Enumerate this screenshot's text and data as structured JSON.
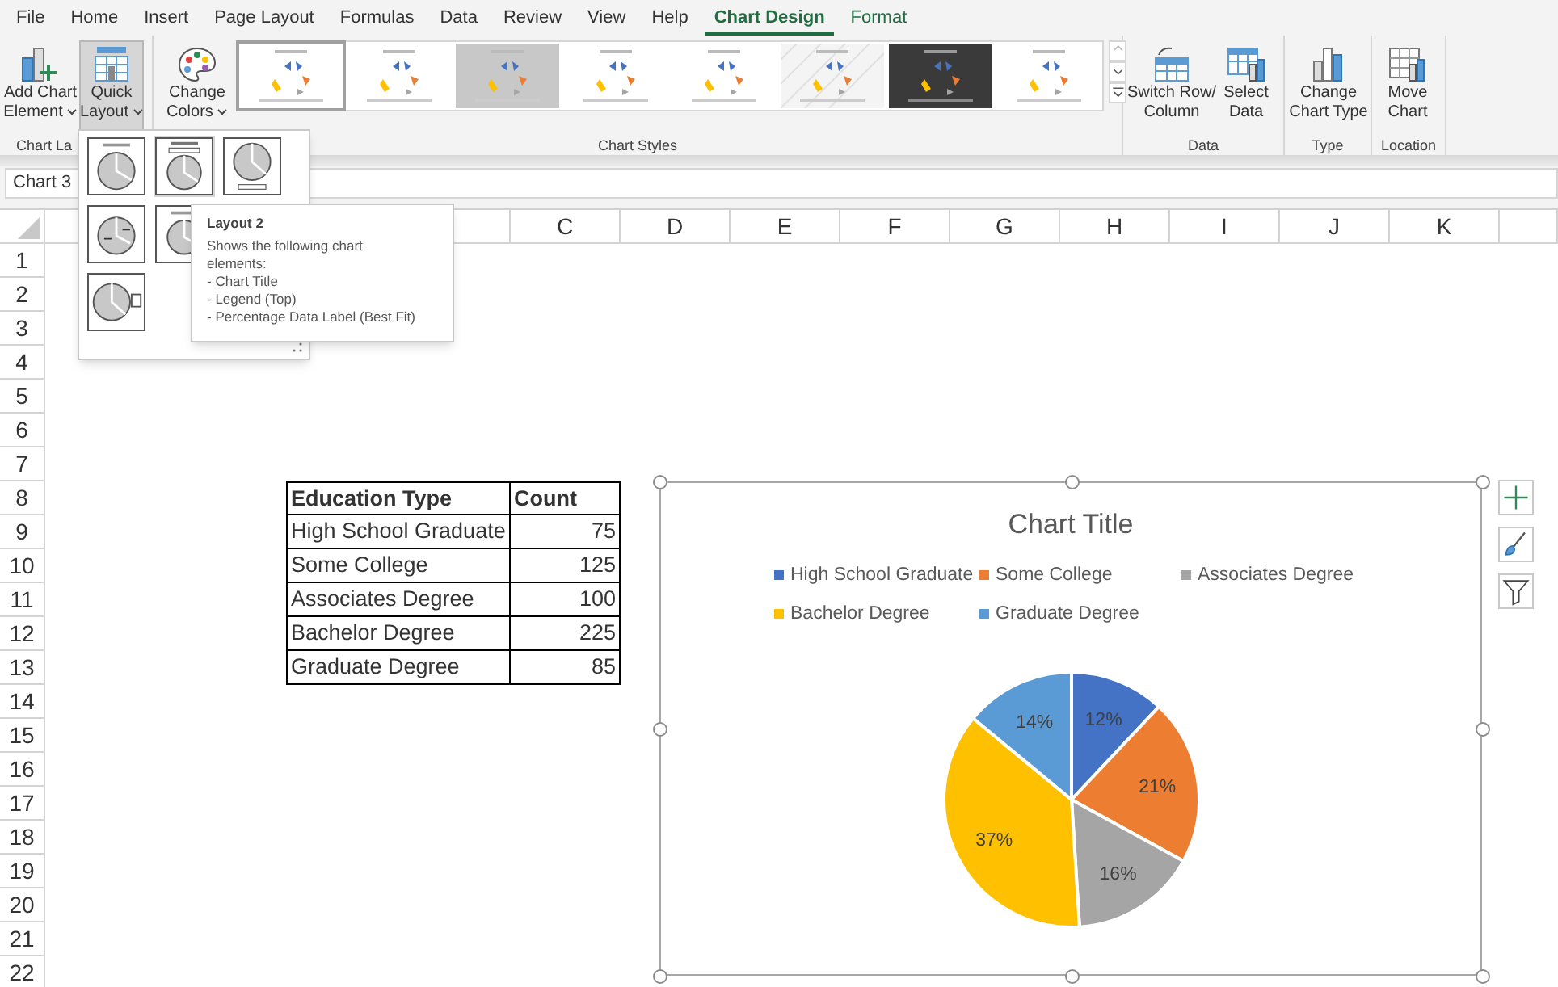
{
  "tabs": [
    {
      "label": "File",
      "selected": false,
      "kind": "normal"
    },
    {
      "label": "Home",
      "selected": false,
      "kind": "normal"
    },
    {
      "label": "Insert",
      "selected": false,
      "kind": "normal"
    },
    {
      "label": "Page Layout",
      "selected": false,
      "kind": "normal"
    },
    {
      "label": "Formulas",
      "selected": false,
      "kind": "normal"
    },
    {
      "label": "Data",
      "selected": false,
      "kind": "normal"
    },
    {
      "label": "Review",
      "selected": false,
      "kind": "normal"
    },
    {
      "label": "View",
      "selected": false,
      "kind": "normal"
    },
    {
      "label": "Help",
      "selected": false,
      "kind": "normal"
    },
    {
      "label": "Chart Design",
      "selected": true,
      "kind": "contextual"
    },
    {
      "label": "Format",
      "selected": false,
      "kind": "contextual"
    }
  ],
  "ribbon": {
    "layouts_group": {
      "label": "Chart La",
      "buttons": [
        {
          "lines": [
            "Add Chart",
            "Element"
          ],
          "dropdown": true,
          "pressed": false
        },
        {
          "lines": [
            "Quick",
            "Layout"
          ],
          "dropdown": true,
          "pressed": true
        }
      ]
    },
    "styles_group": {
      "label": "Chart Styles",
      "color_button": {
        "lines": [
          "Change",
          "Colors"
        ],
        "dropdown": true
      },
      "thumbnails": [
        {
          "kind": "light",
          "selected": true
        },
        {
          "kind": "light",
          "selected": false
        },
        {
          "kind": "gray",
          "selected": false
        },
        {
          "kind": "light",
          "selected": false
        },
        {
          "kind": "light",
          "selected": false
        },
        {
          "kind": "pattern",
          "selected": false
        },
        {
          "kind": "dark",
          "selected": false
        },
        {
          "kind": "light",
          "selected": false
        }
      ]
    },
    "data_group": {
      "label": "Data",
      "buttons": [
        {
          "lines": [
            "Switch Row/",
            "Column"
          ]
        },
        {
          "lines": [
            "Select",
            "Data"
          ]
        }
      ]
    },
    "type_group": {
      "label": "Type",
      "buttons": [
        {
          "lines": [
            "Change",
            "Chart Type"
          ]
        }
      ]
    },
    "location_group": {
      "label": "Location",
      "buttons": [
        {
          "lines": [
            "Move",
            "Chart"
          ]
        }
      ]
    }
  },
  "name_box": {
    "value": "Chart 3"
  },
  "column_headers": [
    "C",
    "D",
    "E",
    "F",
    "G",
    "H",
    "I",
    "J",
    "K"
  ],
  "row_headers": [
    "1",
    "2",
    "3",
    "4",
    "5",
    "6",
    "7",
    "8",
    "9",
    "10",
    "11",
    "12",
    "13",
    "14",
    "15",
    "16",
    "17",
    "18",
    "19",
    "20",
    "21",
    "22"
  ],
  "table": {
    "columns": [
      "Education Type",
      "Count"
    ],
    "rows": [
      [
        "High School Graduate",
        "75"
      ],
      [
        "Some College",
        "125"
      ],
      [
        "Associates Degree",
        "100"
      ],
      [
        "Bachelor Degree",
        "225"
      ],
      [
        "Graduate Degree",
        "85"
      ]
    ]
  },
  "chart": {
    "chart_data": {
      "type": "pie",
      "title": "Chart Title",
      "categories": [
        "High School Graduate",
        "Some College",
        "Associates Degree",
        "Bachelor Degree",
        "Graduate Degree"
      ],
      "series": [
        {
          "values": [
            12,
            21,
            16,
            37,
            14
          ]
        }
      ],
      "legend": true,
      "colors": [
        "#4472c4",
        "#ed7d31",
        "#a5a5a5",
        "#ffc000",
        "#5b9bd5"
      ],
      "value_labels": [
        "12%",
        "21%",
        "16%",
        "37%",
        "14%"
      ]
    }
  },
  "quick_layout_menu": {
    "items": [
      {
        "selected": false
      },
      {
        "selected": true
      },
      {
        "selected": false
      },
      {
        "selected": false
      },
      {
        "selected": false
      },
      {
        "selected": false
      }
    ]
  },
  "tooltip": {
    "title": "Layout 2",
    "lines": [
      "Shows the following chart",
      "elements:",
      "- Chart Title",
      "- Legend (Top)",
      "- Percentage Data Label (Best Fit)"
    ]
  }
}
